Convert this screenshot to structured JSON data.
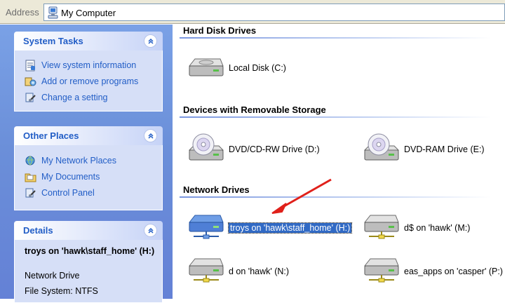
{
  "address_bar": {
    "label": "Address",
    "value": "My Computer",
    "icon": "my-computer-icon"
  },
  "task_pane": {
    "system_tasks": {
      "title": "System Tasks",
      "items": [
        {
          "label": "View system information",
          "icon": "system-info-icon"
        },
        {
          "label": "Add or remove programs",
          "icon": "add-remove-programs-icon"
        },
        {
          "label": "Change a setting",
          "icon": "control-panel-icon"
        }
      ]
    },
    "other_places": {
      "title": "Other Places",
      "items": [
        {
          "label": "My Network Places",
          "icon": "network-places-icon"
        },
        {
          "label": "My Documents",
          "icon": "folder-icon"
        },
        {
          "label": "Control Panel",
          "icon": "control-panel-icon"
        }
      ]
    },
    "details": {
      "title": "Details",
      "name": "troys on 'hawk\\staff_home' (H:)",
      "type": "Network Drive",
      "file_system": "File System: NTFS"
    }
  },
  "content": {
    "groups": [
      {
        "title": "Hard Disk Drives",
        "items": [
          {
            "label": "Local Disk (C:)",
            "icon": "hard-disk-icon"
          }
        ]
      },
      {
        "title": "Devices with Removable Storage",
        "items": [
          {
            "label": "DVD/CD-RW Drive (D:)",
            "icon": "dvd-drive-icon"
          },
          {
            "label": "DVD-RAM Drive (E:)",
            "icon": "dvd-drive-icon"
          }
        ]
      },
      {
        "title": "Network Drives",
        "items": [
          {
            "label": "troys on 'hawk\\staff_home' (H:)",
            "icon": "network-drive-icon",
            "selected": true
          },
          {
            "label": "d$ on 'hawk' (M:)",
            "icon": "network-drive-icon"
          },
          {
            "label": "d on 'hawk' (N:)",
            "icon": "network-drive-icon"
          },
          {
            "label": "eas_apps on 'casper' (P:)",
            "icon": "network-drive-icon"
          }
        ]
      }
    ]
  },
  "colors": {
    "task_pane_bg": "#6b8fd9",
    "link": "#215dc6",
    "selection": "#316ac5",
    "annotation_arrow": "#e0201a"
  }
}
